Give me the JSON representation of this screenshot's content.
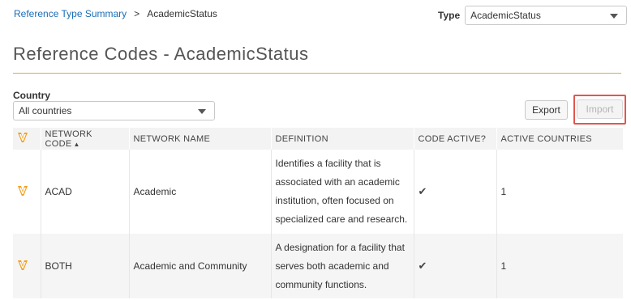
{
  "breadcrumb": {
    "parent": "Reference Type Summary",
    "separator": ">",
    "current": "AcademicStatus"
  },
  "type_filter": {
    "label": "Type",
    "selected": "AcademicStatus"
  },
  "page_title": "Reference Codes - AcademicStatus",
  "country_filter": {
    "label": "Country",
    "selected": "All countries"
  },
  "actions": {
    "export_label": "Export",
    "import_label": "Import"
  },
  "table": {
    "columns": {
      "network_code": "NETWORK CODE",
      "network_name": "NETWORK NAME",
      "definition": "DEFINITION",
      "code_active": "CODE ACTIVE?",
      "active_countries": "ACTIVE COUNTRIES"
    },
    "sort_indicator": "▲",
    "rows": [
      {
        "code": "ACAD",
        "name": "Academic",
        "definition": "Identifies a facility that is associated with an academic institution, often focused on specialized care and research.",
        "active_mark": "✔",
        "active_countries": "1"
      },
      {
        "code": "BOTH",
        "name": "Academic and Community",
        "definition": "A designation for a facility that serves both academic and community functions.",
        "active_mark": "✔",
        "active_countries": "1"
      }
    ]
  },
  "colors": {
    "link": "#1a6db5",
    "accent": "#e6a54a",
    "highlight": "#e2564f"
  },
  "icons": {
    "brand": "veeva-v-icon",
    "check": "checkmark-icon",
    "caret": "chevron-down-icon"
  }
}
